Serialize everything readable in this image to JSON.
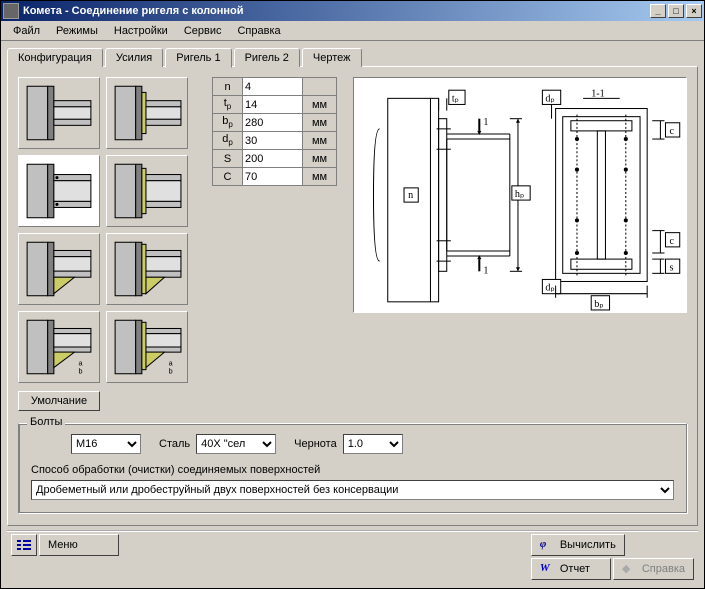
{
  "window": {
    "title": "Комета - Соединение ригеля с колонной",
    "min": "_",
    "max": "□",
    "close": "×"
  },
  "menu": {
    "file": "Файл",
    "modes": "Режимы",
    "settings": "Настройки",
    "service": "Сервис",
    "help": "Справка"
  },
  "tabs": {
    "config": "Конфигурация",
    "forces": "Усилия",
    "beam1": "Ригель 1",
    "beam2": "Ригель 2",
    "drawing": "Чертеж"
  },
  "params": {
    "rows": [
      {
        "label": "n",
        "sub": "",
        "value": "4",
        "unit": ""
      },
      {
        "label": "t",
        "sub": "p",
        "value": "14",
        "unit": "мм"
      },
      {
        "label": "b",
        "sub": "p",
        "value": "280",
        "unit": "мм"
      },
      {
        "label": "d",
        "sub": "p",
        "value": "30",
        "unit": "мм"
      },
      {
        "label": "S",
        "sub": "",
        "value": "200",
        "unit": "мм"
      },
      {
        "label": "C",
        "sub": "",
        "value": "70",
        "unit": "мм"
      }
    ]
  },
  "diagram_labels": {
    "n": "n",
    "tp": "tₚ",
    "hp": "hₚ",
    "dp": "dₚ",
    "bp": "bₚ",
    "s": "s",
    "c": "c",
    "sec11": "1-1",
    "one": "1"
  },
  "default_btn": "Умолчание",
  "bolts": {
    "group_title": "Болты",
    "size": "M16",
    "steel_label": "Сталь",
    "steel_value": "40X \"сел",
    "black_label": "Чернота",
    "black_value": "1.0",
    "surface_label": "Способ обработки (очистки) соединяемых поверхностей",
    "surface_value": "Дробеметный или дробеструйный двух поверхностей без консервации"
  },
  "bottom": {
    "menu": "Меню",
    "calc": "Вычислить",
    "report": "Отчет",
    "help": "Справка"
  }
}
